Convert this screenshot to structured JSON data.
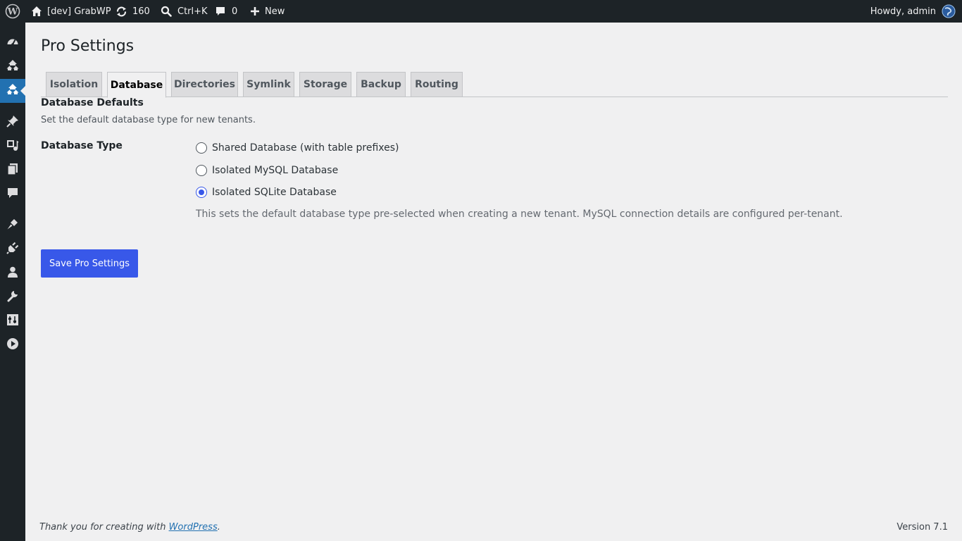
{
  "admin_bar": {
    "site_name": "[dev] GrabWP",
    "updates_count": "160",
    "search_shortcut": "Ctrl+K",
    "comments_count": "0",
    "new_label": "New",
    "greeting": "Howdy, admin"
  },
  "side_menu": {
    "icons": [
      "dashboard-icon",
      "multisite-icon",
      "multisite-icon",
      "pin-icon",
      "media-icon",
      "pages-icon",
      "comments-icon",
      "appearance-icon",
      "plugins-icon",
      "users-icon",
      "tools-icon",
      "settings-icon",
      "media-player-icon"
    ],
    "current_index": 2
  },
  "page": {
    "title": "Pro Settings",
    "tabs": [
      "Isolation",
      "Database",
      "Directories",
      "Symlink",
      "Storage",
      "Backup",
      "Routing"
    ],
    "active_tab": "Database",
    "section_title": "Database Defaults",
    "section_description": "Set the default database type for new tenants.",
    "field_label": "Database Type",
    "options": [
      "Shared Database (with table prefixes)",
      "Isolated MySQL Database",
      "Isolated SQLite Database"
    ],
    "selected_option": "Isolated SQLite Database",
    "help_text": "This sets the default database type pre-selected when creating a new tenant. MySQL connection details are configured per-tenant.",
    "save_label": "Save Pro Settings"
  },
  "footer": {
    "thanks_prefix": "Thank you for creating with ",
    "wordpress_link": "WordPress",
    "thanks_suffix": ".",
    "version": "Version 7.1"
  },
  "colors": {
    "admin_bar_bg": "#1d2327",
    "accent": "#3858e9",
    "page_bg": "#f0f0f1"
  }
}
